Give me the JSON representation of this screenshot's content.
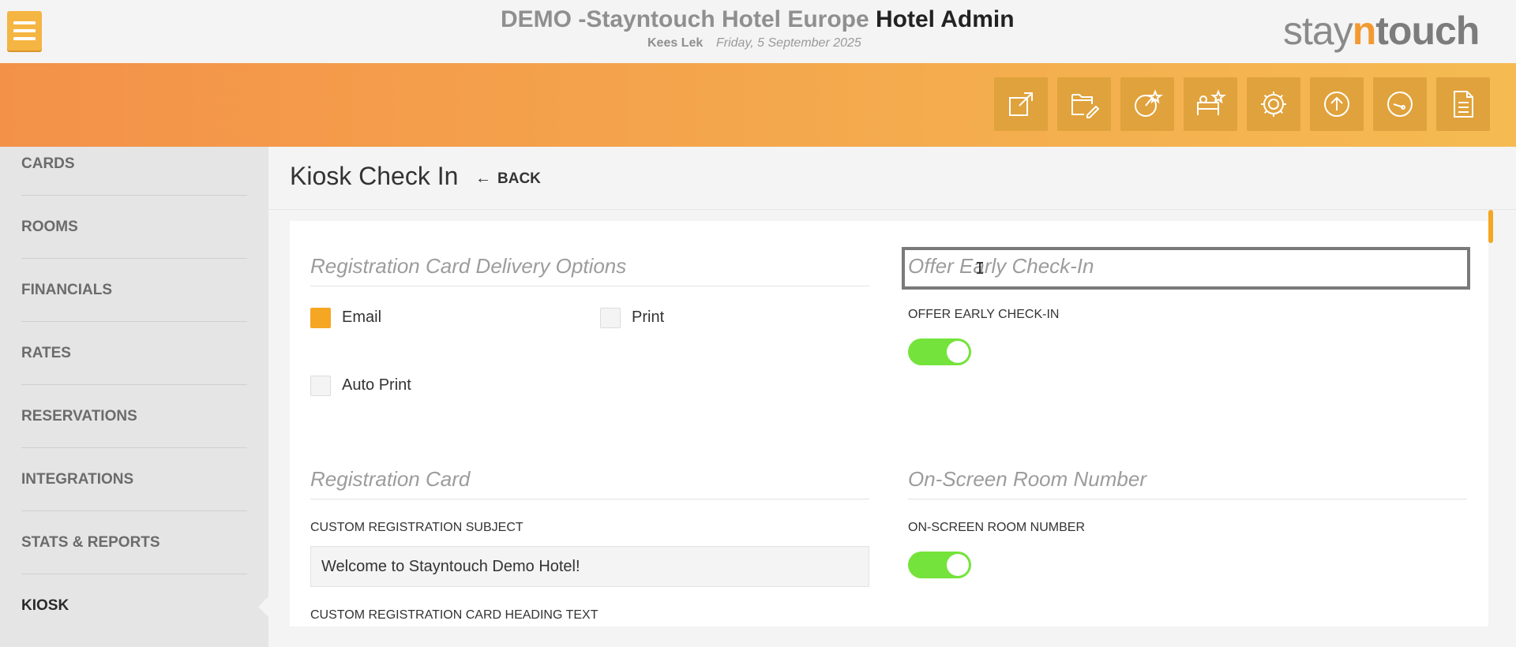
{
  "header": {
    "hotel_name": "DEMO -Stayntouch Hotel Europe",
    "app_title": "Hotel Admin",
    "user": "Kees Lek",
    "date": "Friday, 5 September 2025",
    "logo": {
      "part1": "stay",
      "part2": "n",
      "part3": "touch"
    }
  },
  "toolbar": {
    "icons": [
      "external-link-icon",
      "folder-edit-icon",
      "chart-star-icon",
      "bed-star-icon",
      "gear-icon",
      "upload-icon",
      "dashboard-icon",
      "document-icon"
    ]
  },
  "sidebar": {
    "items": [
      {
        "label": "CARDS"
      },
      {
        "label": "ROOMS"
      },
      {
        "label": "FINANCIALS"
      },
      {
        "label": "RATES"
      },
      {
        "label": "RESERVATIONS"
      },
      {
        "label": "INTEGRATIONS"
      },
      {
        "label": "STATS & REPORTS"
      },
      {
        "label": "KIOSK"
      }
    ],
    "active": "KIOSK"
  },
  "page": {
    "title": "Kiosk Check In",
    "back_label": "BACK"
  },
  "delivery": {
    "title": "Registration Card Delivery Options",
    "email_label": "Email",
    "email_checked": true,
    "print_label": "Print",
    "print_checked": false,
    "auto_print_label": "Auto Print",
    "auto_print_checked": false
  },
  "early_checkin": {
    "title": "Offer Early Check-In",
    "toggle_label": "OFFER EARLY CHECK-IN",
    "enabled": true
  },
  "registration_card": {
    "title": "Registration Card",
    "subject_label": "CUSTOM REGISTRATION SUBJECT",
    "subject_value": "Welcome to Stayntouch Demo Hotel!",
    "heading_label": "CUSTOM REGISTRATION CARD HEADING TEXT"
  },
  "room_number": {
    "title": "On-Screen Room Number",
    "toggle_label": "ON-SCREEN ROOM NUMBER",
    "enabled": true
  },
  "colors": {
    "accent": "#f5a623",
    "toggle_on": "#74e33b",
    "toolbar_start": "#f39149",
    "toolbar_end": "#f5bb52"
  }
}
